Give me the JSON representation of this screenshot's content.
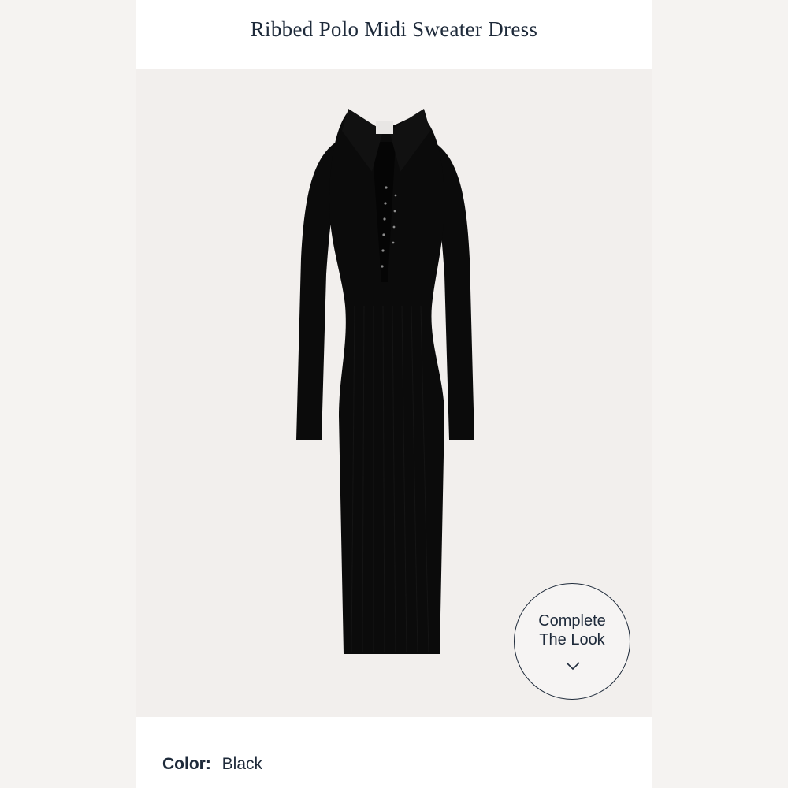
{
  "product": {
    "title": "Ribbed Polo Midi Sweater Dress",
    "color_label": "Color:",
    "color_value": "Black",
    "image_subject": "black ribbed polo midi dress"
  },
  "complete_the_look": {
    "line1": "Complete",
    "line2": "The Look",
    "icon": "chevron-down-icon"
  },
  "colors": {
    "panel_bg": "#ffffff",
    "photo_bg": "#f2efed",
    "text": "#1e2a3a",
    "garment": "#0b0b0b"
  }
}
